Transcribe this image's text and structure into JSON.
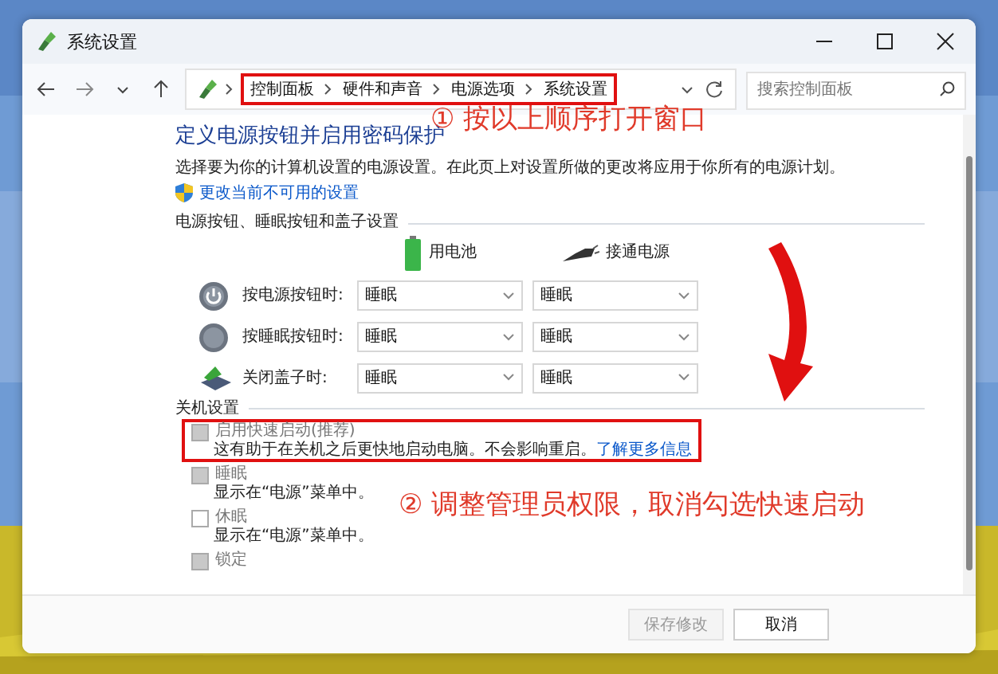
{
  "window": {
    "title": "系统设置"
  },
  "navigation": {
    "breadcrumb": {
      "highlighted": true,
      "items": [
        "控制面板",
        "硬件和声音",
        "电源选项",
        "系统设置"
      ]
    },
    "search": {
      "placeholder": "搜索控制面板"
    }
  },
  "page": {
    "heading": "定义电源按钮并启用密码保护",
    "description": "选择要为你的计算机设置的电源设置。在此页上对设置所做的更改将应用于你所有的电源计划。",
    "admin_link": "更改当前不可用的设置"
  },
  "buttons_section": {
    "title": "电源按钮、睡眠按钮和盖子设置",
    "columns": [
      {
        "kind": "battery",
        "label": "用电池"
      },
      {
        "kind": "plug",
        "label": "接通电源"
      }
    ],
    "rows": [
      {
        "kind": "power",
        "label": "按电源按钮时:",
        "values": [
          "睡眠",
          "睡眠"
        ]
      },
      {
        "kind": "sleep",
        "label": "按睡眠按钮时:",
        "values": [
          "睡眠",
          "睡眠"
        ]
      },
      {
        "kind": "lid",
        "label": "关闭盖子时:",
        "values": [
          "睡眠",
          "睡眠"
        ]
      }
    ]
  },
  "shutdown_section": {
    "title": "关机设置",
    "options": [
      {
        "label": "启用快速启动(推荐)",
        "checked": true,
        "disabled": true,
        "highlighted": true,
        "description": "这有助于在关机之后更快地启动电脑。不会影响重启。",
        "link": "了解更多信息"
      },
      {
        "label": "睡眠",
        "checked": true,
        "disabled": true,
        "highlighted": false,
        "description": "显示在“电源”菜单中。"
      },
      {
        "label": "休眠",
        "checked": false,
        "disabled": true,
        "highlighted": false,
        "description": "显示在“电源”菜单中。"
      },
      {
        "label": "锁定",
        "checked": true,
        "disabled": true,
        "highlighted": false
      }
    ]
  },
  "footer": {
    "buttons": [
      {
        "label": "保存修改",
        "disabled": true
      },
      {
        "label": "取消",
        "disabled": false
      }
    ]
  },
  "annotations": [
    {
      "kind": "note",
      "text": "① 按以上顺序打开窗口"
    },
    {
      "kind": "note",
      "text": "② 调整管理员权限，取消勾选快速启动"
    }
  ]
}
